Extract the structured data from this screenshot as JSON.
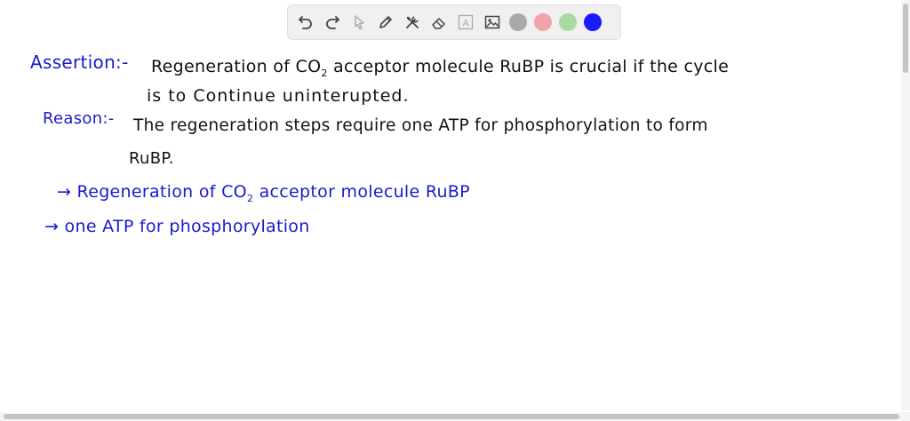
{
  "toolbar": {
    "tools": [
      {
        "name": "undo-icon"
      },
      {
        "name": "redo-icon"
      },
      {
        "name": "pointer-icon"
      },
      {
        "name": "pen-icon"
      },
      {
        "name": "tools-icon"
      },
      {
        "name": "eraser-icon"
      },
      {
        "name": "text-icon",
        "label": "A"
      },
      {
        "name": "image-icon"
      }
    ],
    "colors": [
      "#a9a9a9",
      "#f1a3aa",
      "#a8dba2",
      "#1a1aff"
    ]
  },
  "notes": {
    "assertion_label": "Assertion:-",
    "assertion_line1_a": "Regeneration of CO",
    "assertion_line1_sub": "2",
    "assertion_line1_b": " acceptor molecule RuBP is crucial if the cycle",
    "assertion_line2": "is to Continue uninterupted.",
    "reason_label": "Reason:-",
    "reason_line1": "The regeneration steps require one ATP for phosphorylation to form",
    "reason_line2": "RuBP.",
    "point1_a": "→ Regeneration of CO",
    "point1_sub": "2",
    "point1_b": " acceptor molecule RuBP",
    "point2": "→ one ATP for phosphorylation"
  },
  "colors": {
    "ink_black": "#111111",
    "ink_blue": "#1a1acc"
  }
}
